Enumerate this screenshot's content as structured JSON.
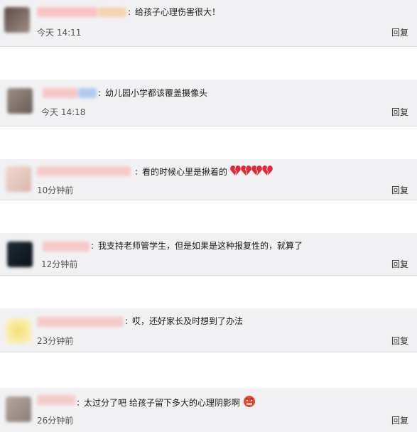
{
  "comments": [
    {
      "separator": ":",
      "text": "给孩子心理伤害很大！",
      "time": "今天 14:11",
      "reply_label": "回复"
    },
    {
      "separator": ":",
      "text": "幼儿园小学都该覆盖摄像头",
      "time": "今天 14:18",
      "reply_label": "回复"
    },
    {
      "separator": ":",
      "text": "看的时候心里是揪着的",
      "time": "10分钟前",
      "reply_label": "回复",
      "emoji": "broken-heart-icon"
    },
    {
      "separator": ":",
      "text": "我支持老师管学生，但是如果是这种报复性的，就算了",
      "time": "12分钟前",
      "reply_label": "回复"
    },
    {
      "separator": ":",
      "text": "哎，还好家长及时想到了办法",
      "time": "23分钟前",
      "reply_label": "回复"
    },
    {
      "separator": ":",
      "text": "太过分了吧 给孩子留下多大的心理阴影啊",
      "time": "26分钟前",
      "reply_label": "回复",
      "emoji": "angry-face-icon"
    }
  ],
  "colors": {
    "card_background": "#f1f1f3",
    "page_background": "#ffffff",
    "name_blur": "#f6b3b3"
  }
}
